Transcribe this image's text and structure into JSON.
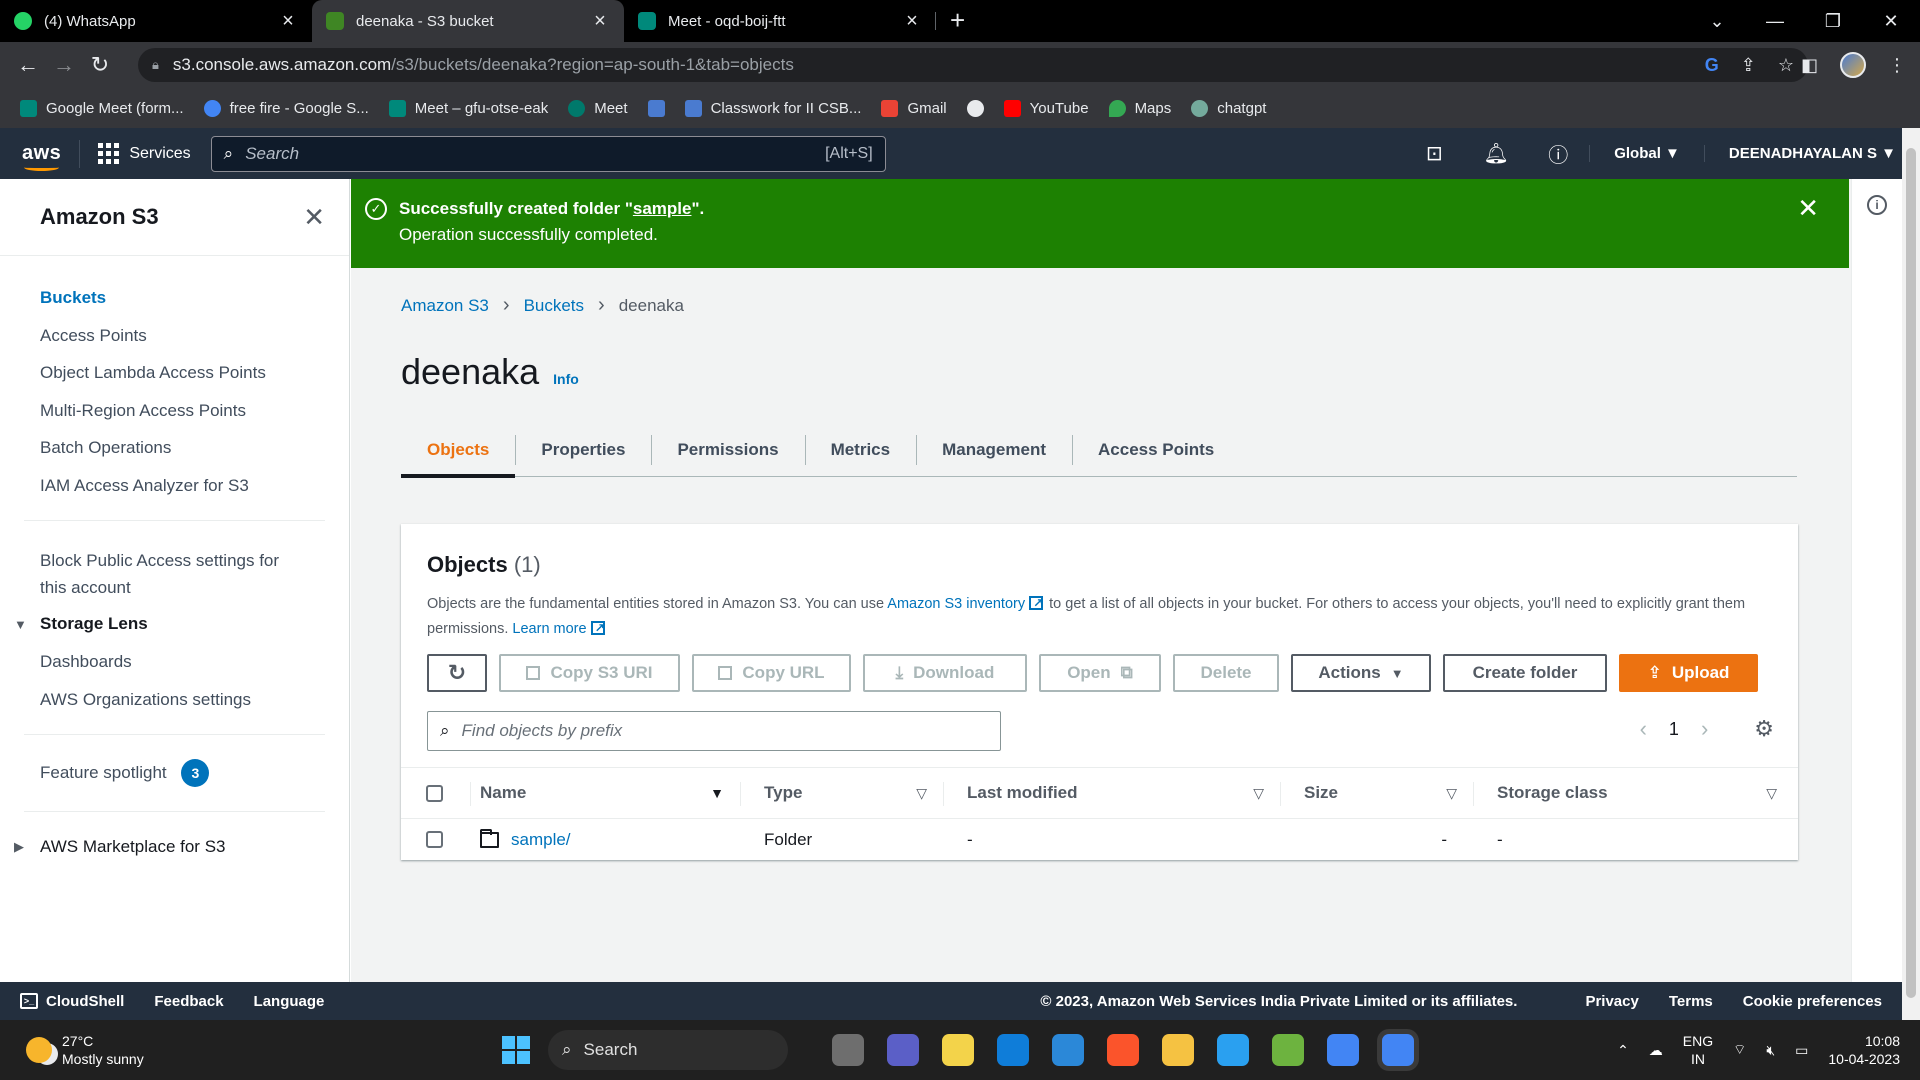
{
  "browser": {
    "tabs": [
      {
        "title": "(4) WhatsApp",
        "color": "#25d366",
        "active": false
      },
      {
        "title": "deenaka - S3 bucket",
        "color": "#3f8624",
        "active": true
      },
      {
        "title": "Meet - oqd-boij-ftt",
        "color": "#00897b",
        "active": false
      }
    ],
    "url_host": "s3.console.aws.amazon.com",
    "url_path": "/s3/buckets/deenaka?region=ap-south-1&tab=objects",
    "bookmarks": [
      {
        "label": "Google Meet (form...",
        "color": "#00897b"
      },
      {
        "label": "free fire - Google S...",
        "color": "#4285f4"
      },
      {
        "label": "Meet – gfu-otse-eak",
        "color": "#00897b"
      },
      {
        "label": "Meet",
        "color": "#00796b"
      },
      {
        "label": "",
        "color": "#4a7bd0"
      },
      {
        "label": "Classwork for II CSB...",
        "color": "#4a7bd0"
      },
      {
        "label": "Gmail",
        "color": "#ea4335"
      },
      {
        "label": "",
        "color": "#e8eaed"
      },
      {
        "label": "YouTube",
        "color": "#ff0000"
      },
      {
        "label": "Maps",
        "color": "#34a853"
      },
      {
        "label": "chatgpt",
        "color": "#74aa9c"
      }
    ]
  },
  "awsnav": {
    "logo": "aws",
    "services": "Services",
    "search_placeholder": "Search",
    "search_shortcut": "[Alt+S]",
    "region": "Global ▼",
    "user": "DEENADHAYALAN S ▼"
  },
  "sidebar": {
    "title": "Amazon S3",
    "items": [
      "Buckets",
      "Access Points",
      "Object Lambda Access Points",
      "Multi-Region Access Points",
      "Batch Operations",
      "IAM Access Analyzer for S3"
    ],
    "block_public": "Block Public Access settings for this account",
    "storage_lens": "Storage Lens",
    "storage_lens_items": [
      "Dashboards",
      "AWS Organizations settings"
    ],
    "feature_spotlight": "Feature spotlight",
    "feature_count": "3",
    "marketplace": "AWS Marketplace for S3"
  },
  "flash": {
    "prefix": "Successfully created folder \"",
    "folder": "sample",
    "suffix": "\".",
    "message": "Operation successfully completed."
  },
  "breadcrumb": {
    "root": "Amazon S3",
    "buckets": "Buckets",
    "current": "deenaka"
  },
  "page": {
    "title": "deenaka",
    "info": "Info"
  },
  "tabs": [
    "Objects",
    "Properties",
    "Permissions",
    "Metrics",
    "Management",
    "Access Points"
  ],
  "objects": {
    "title": "Objects",
    "count": "(1)",
    "desc1": "Objects are the fundamental entities stored in Amazon S3. You can use",
    "desc_link1": "Amazon S3 inventory",
    "desc2": "to get a list of all objects in your bucket. For others to access your objects, you'll need to explicitly grant them permissions.",
    "desc_link2": "Learn more",
    "buttons": {
      "copy_uri": "Copy S3 URI",
      "copy_url": "Copy URL",
      "download": "Download",
      "open": "Open",
      "delete": "Delete",
      "actions": "Actions",
      "create_folder": "Create folder",
      "upload": "Upload"
    },
    "find_placeholder": "Find objects by prefix",
    "page": "1",
    "columns": [
      "Name",
      "Type",
      "Last modified",
      "Size",
      "Storage class"
    ],
    "rows": [
      {
        "name": "sample/",
        "type": "Folder",
        "modified": "-",
        "size": "-",
        "class": "-"
      }
    ]
  },
  "footer": {
    "cloudshell": "CloudShell",
    "feedback": "Feedback",
    "language": "Language",
    "copyright": "© 2023, Amazon Web Services India Private Limited or its affiliates.",
    "privacy": "Privacy",
    "terms": "Terms",
    "cookies": "Cookie preferences"
  },
  "taskbar": {
    "temp": "27°C",
    "weather": "Mostly sunny",
    "search": "Search",
    "lang1": "ENG",
    "lang2": "IN",
    "time": "10:08",
    "date": "10-04-2023",
    "apps": [
      "#6e6e6e",
      "#5b5fc7",
      "#f3d34a",
      "#0f7dd9",
      "#2b88d8",
      "#fb542b",
      "#f5c242",
      "#2aa0f0",
      "#6db33f",
      "#4285f4",
      "#4285f4"
    ]
  }
}
